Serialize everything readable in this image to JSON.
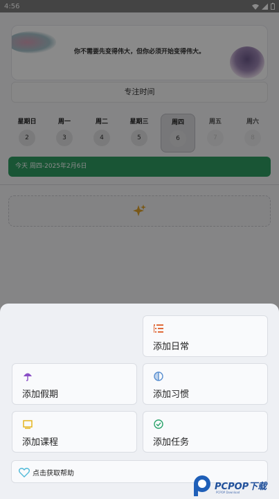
{
  "statusbar": {
    "time": "4:56"
  },
  "quote": {
    "text": "你不需要先变得伟大，但你必须开始变得伟大。"
  },
  "focus_button": {
    "label": "专注时间"
  },
  "week": [
    {
      "name": "星期日",
      "num": "2"
    },
    {
      "name": "周一",
      "num": "3"
    },
    {
      "name": "周二",
      "num": "4"
    },
    {
      "name": "星期三",
      "num": "5"
    },
    {
      "name": "周四",
      "num": "6"
    },
    {
      "name": "周五",
      "num": "7"
    },
    {
      "name": "周六",
      "num": "8"
    }
  ],
  "today_bar": {
    "text": "今天 周四-2025年2月6日"
  },
  "sheet": {
    "actions": {
      "routine": {
        "label": "添加日常",
        "icon": "list-icon",
        "color": "#e06a3a"
      },
      "holiday": {
        "label": "添加假期",
        "icon": "umbrella-icon",
        "color": "#8a4fc6"
      },
      "habit": {
        "label": "添加习惯",
        "icon": "half-circle-icon",
        "color": "#5a8fd0"
      },
      "course": {
        "label": "添加课程",
        "icon": "screen-icon",
        "color": "#e3b011"
      },
      "task": {
        "label": "添加任务",
        "icon": "check-circle-icon",
        "color": "#29a36a"
      }
    },
    "help": {
      "label": "点击获取帮助",
      "icon": "heart-icon",
      "color": "#4fb9d8"
    }
  },
  "watermark": {
    "text": "PCPOP下载",
    "sub": "PCPOP Download"
  }
}
